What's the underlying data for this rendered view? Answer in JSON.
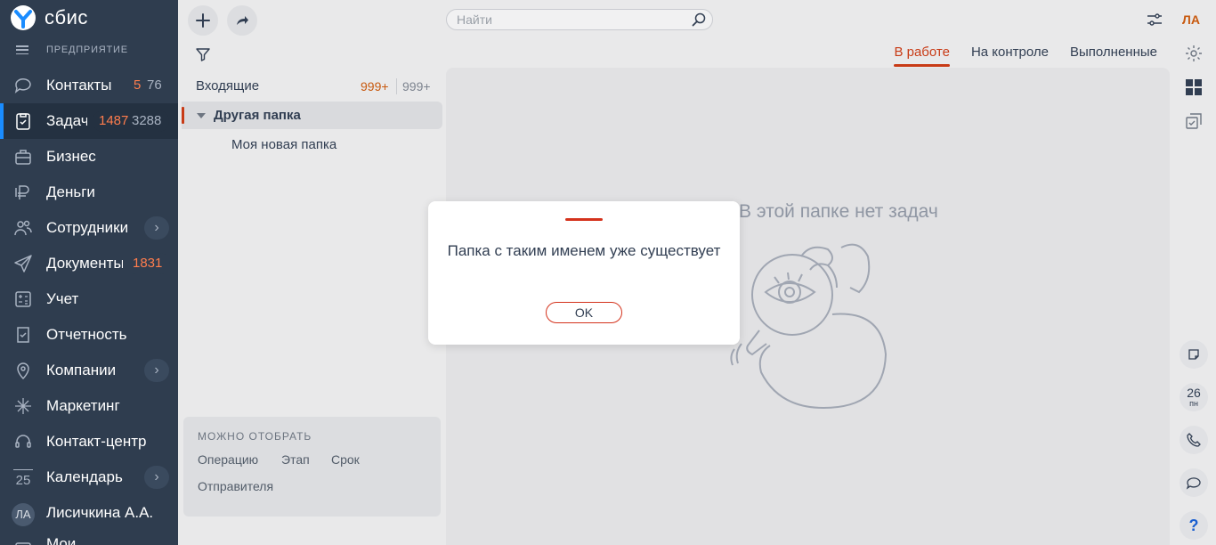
{
  "brand": {
    "name": "сбис"
  },
  "org": {
    "label": "ПРЕДПРИЯТИЕ"
  },
  "nav": {
    "contacts": {
      "label": "Контакты",
      "count_new": "5",
      "count_total": "76"
    },
    "tasks": {
      "label": "Задачи",
      "count_new": "1487",
      "count_total": "3288"
    },
    "business": {
      "label": "Бизнес"
    },
    "money": {
      "label": "Деньги"
    },
    "staff": {
      "label": "Сотрудники",
      "chevron": "›"
    },
    "documents": {
      "label": "Документы",
      "count_new": "1831"
    },
    "accounting": {
      "label": "Учет"
    },
    "reports": {
      "label": "Отчетность"
    },
    "companies": {
      "label": "Компании",
      "chevron": "›"
    },
    "marketing": {
      "label": "Маркетинг"
    },
    "contact_center": {
      "label": "Контакт-центр"
    },
    "calendar": {
      "label": "Календарь",
      "icon_text": "25",
      "chevron": "›"
    },
    "user": {
      "label": "Лисичкина А.А.",
      "initials": "ЛА"
    },
    "more": {
      "label": "Мои..."
    }
  },
  "search": {
    "placeholder": "Найти"
  },
  "tabs": [
    {
      "label": "В работе",
      "active": true
    },
    {
      "label": "На контроле",
      "active": false
    },
    {
      "label": "Выполненные",
      "active": false
    }
  ],
  "folders": {
    "incoming": {
      "label": "Входящие",
      "count_new": "999+",
      "count_total": "999+"
    },
    "other": {
      "label": "Другая папка",
      "expanded": true
    },
    "new": {
      "label": "Моя новая папка"
    }
  },
  "filter_panel": {
    "title": "МОЖНО ОТОБРАТЬ",
    "options": [
      "Операцию",
      "Этап",
      "Срок",
      "Отправителя"
    ]
  },
  "empty_state": {
    "text": "В этой папке нет задач"
  },
  "right_rail": {
    "initials": "ЛА",
    "day": "26",
    "weekday": "пн",
    "help": "?"
  },
  "dialog": {
    "message": "Папка с таким именем уже существует",
    "ok_label": "OK",
    "accent_color": "#d4321c"
  },
  "colors": {
    "sidebar": "#2f3d4f",
    "accent_orange": "#c85a10",
    "active_tab": "#c83b16",
    "active_nav_marker": "#1a8cff"
  }
}
